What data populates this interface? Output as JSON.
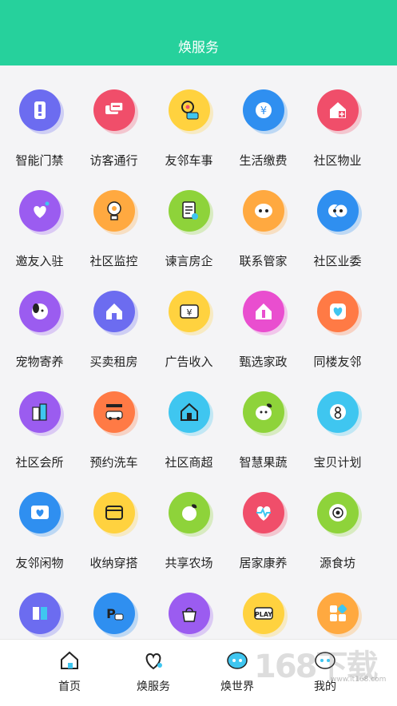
{
  "header": {
    "title": "焕服务"
  },
  "services": [
    {
      "label": "智能门禁",
      "icon": "door-access-icon",
      "color": "#6c6cf0"
    },
    {
      "label": "访客通行",
      "icon": "visitor-pass-icon",
      "color": "#f04e6a"
    },
    {
      "label": "友邻车事",
      "icon": "location-car-icon",
      "color": "#ffd23f"
    },
    {
      "label": "生活缴费",
      "icon": "yuan-payment-icon",
      "color": "#2f8ff0"
    },
    {
      "label": "社区物业",
      "icon": "property-house-icon",
      "color": "#f04e6a"
    },
    {
      "label": "邀友入驻",
      "icon": "heart-invite-icon",
      "color": "#9b5cf0"
    },
    {
      "label": "社区监控",
      "icon": "camera-monitor-icon",
      "color": "#ffa940"
    },
    {
      "label": "谏言房企",
      "icon": "document-advice-icon",
      "color": "#8ed33a"
    },
    {
      "label": "联系管家",
      "icon": "chat-face-icon",
      "color": "#ffa940"
    },
    {
      "label": "社区业委",
      "icon": "committee-icon",
      "color": "#2f8ff0"
    },
    {
      "label": "宠物寄养",
      "icon": "pet-dog-icon",
      "color": "#9b5cf0"
    },
    {
      "label": "买卖租房",
      "icon": "house-rent-icon",
      "color": "#6c6cf0"
    },
    {
      "label": "广告收入",
      "icon": "ad-income-icon",
      "color": "#ffd23f"
    },
    {
      "label": "甄选家政",
      "icon": "housekeeping-icon",
      "color": "#e94ecf"
    },
    {
      "label": "同楼友邻",
      "icon": "neighbor-heart-icon",
      "color": "#ff7a45"
    },
    {
      "label": "社区会所",
      "icon": "clubhouse-icon",
      "color": "#9b5cf0"
    },
    {
      "label": "预约洗车",
      "icon": "car-wash-icon",
      "color": "#ff7a45"
    },
    {
      "label": "社区商超",
      "icon": "supermarket-icon",
      "color": "#3fc6f0"
    },
    {
      "label": "智慧果蔬",
      "icon": "fruit-veg-icon",
      "color": "#8ed33a"
    },
    {
      "label": "宝贝计划",
      "icon": "baby-plan-icon",
      "color": "#3fc6f0"
    },
    {
      "label": "友邻闲物",
      "icon": "secondhand-box-icon",
      "color": "#2f8ff0"
    },
    {
      "label": "收纳穿搭",
      "icon": "storage-box-icon",
      "color": "#ffd23f"
    },
    {
      "label": "共享农场",
      "icon": "farm-fruit-icon",
      "color": "#8ed33a"
    },
    {
      "label": "居家康养",
      "icon": "health-heart-icon",
      "color": "#f04e6a"
    },
    {
      "label": "源食坊",
      "icon": "food-flower-icon",
      "color": "#8ed33a"
    },
    {
      "label": "",
      "icon": "card-icon",
      "color": "#6c6cf0"
    },
    {
      "label": "",
      "icon": "parking-icon",
      "color": "#2f8ff0"
    },
    {
      "label": "",
      "icon": "bag-icon",
      "color": "#9b5cf0"
    },
    {
      "label": "",
      "icon": "play-icon",
      "color": "#ffd23f"
    },
    {
      "label": "",
      "icon": "apps-icon",
      "color": "#ffa940"
    }
  ],
  "tabbar": [
    {
      "label": "首页",
      "icon": "home-tab-icon"
    },
    {
      "label": "焕服务",
      "icon": "service-tab-icon"
    },
    {
      "label": "焕世界",
      "icon": "world-tab-icon"
    },
    {
      "label": "我的",
      "icon": "profile-tab-icon"
    }
  ],
  "watermark": {
    "text": "168下载",
    "url": "www.it168.com"
  }
}
